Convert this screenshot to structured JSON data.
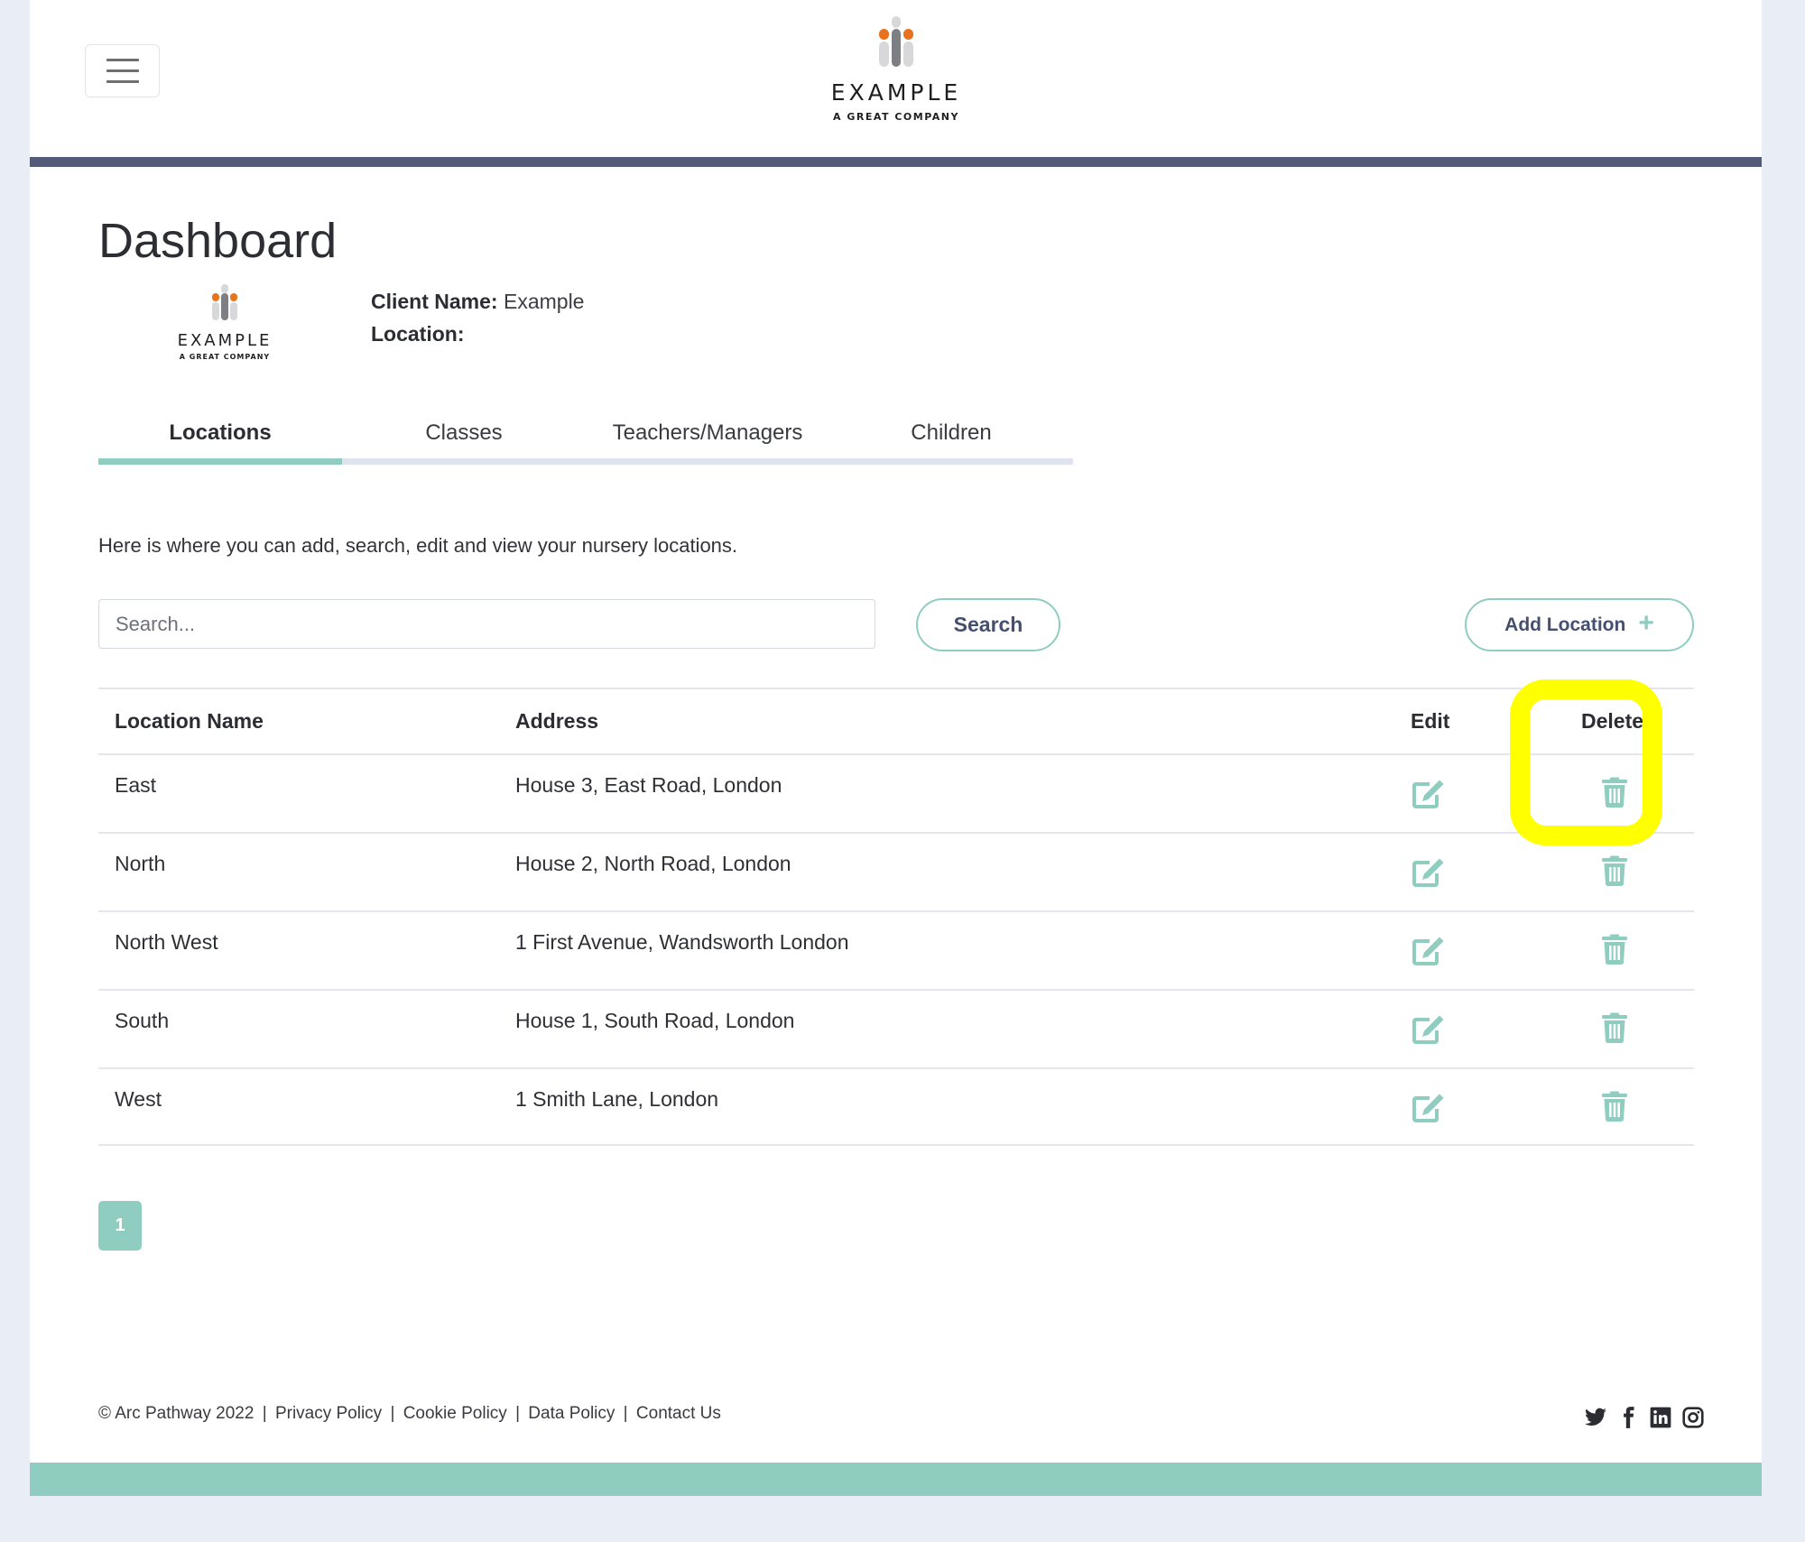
{
  "header": {
    "menu_button_label": "Menu",
    "logo": {
      "name": "EXAMPLE",
      "tagline": "A GREAT COMPANY"
    }
  },
  "page": {
    "title": "Dashboard",
    "client_logo": {
      "name": "EXAMPLE",
      "tagline": "A GREAT COMPANY"
    },
    "client_name_label": "Client Name:",
    "client_name_value": "Example",
    "location_label": "Location:",
    "location_value": ""
  },
  "tabs": [
    {
      "label": "Locations",
      "active": true
    },
    {
      "label": "Classes",
      "active": false
    },
    {
      "label": "Teachers/Managers",
      "active": false
    },
    {
      "label": "Children",
      "active": false
    }
  ],
  "description": "Here is where you can add, search, edit and view your nursery locations.",
  "search": {
    "placeholder": "Search...",
    "value": "",
    "button_label": "Search"
  },
  "add_button": {
    "label": "Add Location",
    "icon": "plus-icon"
  },
  "table": {
    "columns": [
      "Location Name",
      "Address",
      "Edit",
      "Delete"
    ],
    "rows": [
      {
        "name": "East",
        "address": "House 3, East Road, London"
      },
      {
        "name": "North",
        "address": "House 2, North Road, London"
      },
      {
        "name": "North West",
        "address": "1 First Avenue, Wandsworth London"
      },
      {
        "name": "South",
        "address": "House 1, South Road, London"
      },
      {
        "name": "West",
        "address": "1 Smith Lane, London"
      }
    ],
    "row_icons": {
      "edit": "edit-icon",
      "delete": "trash-icon"
    }
  },
  "pagination": {
    "current_page": "1",
    "pages": [
      "1"
    ]
  },
  "footer": {
    "copyright": "© Arc Pathway 2022",
    "links": [
      "Privacy Policy",
      "Cookie Policy",
      "Data Policy",
      "Contact Us"
    ],
    "social": [
      "twitter-icon",
      "facebook-icon",
      "linkedin-icon",
      "instagram-icon"
    ]
  },
  "colors": {
    "accent_teal": "#8ecdc0",
    "navy": "#525c7a",
    "button_text": "#454f6f",
    "page_background": "#e9edf5",
    "logo_orange": "#e8731e",
    "highlight_annotation": "#ffff00"
  },
  "annotation": {
    "type": "highlight-box",
    "target": "Delete column / first row delete button"
  }
}
